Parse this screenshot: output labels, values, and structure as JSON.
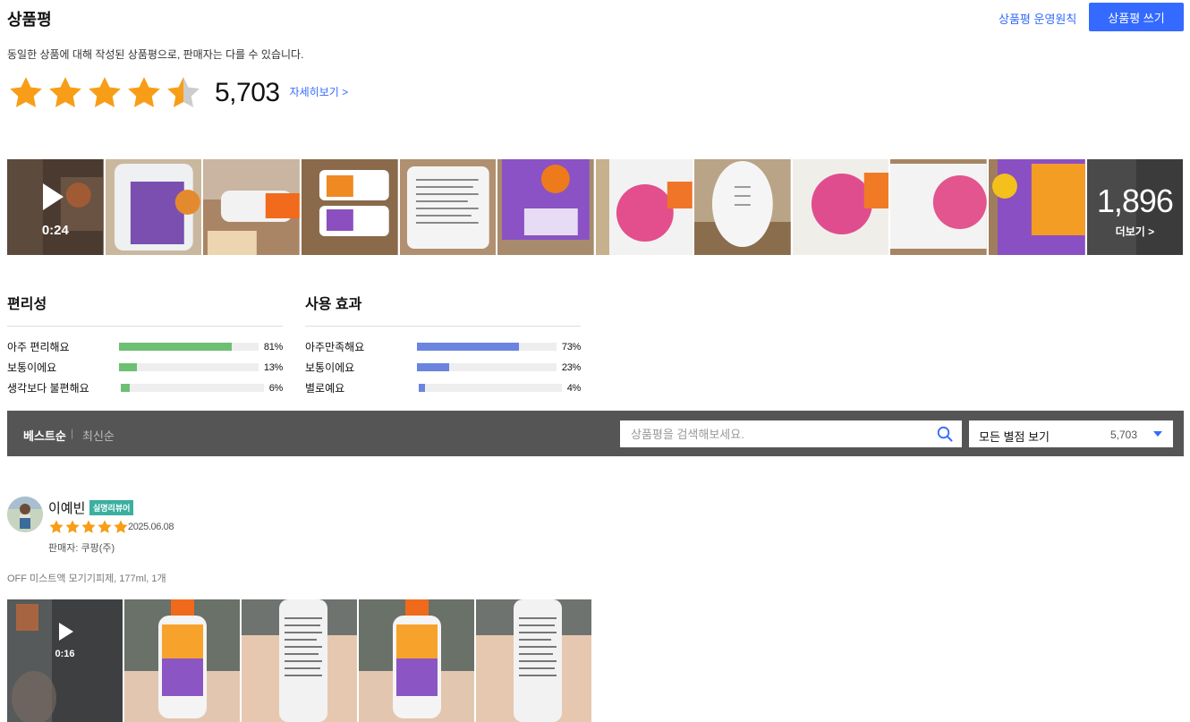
{
  "header": {
    "title": "상품평",
    "policy_link": "상품평 운영원칙",
    "write_button": "상품평 쓰기",
    "notice": "동일한 상품에 대해 작성된 상품평으로, 판매자는 다를 수 있습니다."
  },
  "summary": {
    "rating": 4.5,
    "max_rating": 5,
    "review_count": "5,703",
    "detail_link": "자세히보기 >"
  },
  "gallery": {
    "video_duration": "0:24",
    "more_count": "1,896",
    "more_label": "더보기 >"
  },
  "surveys": [
    {
      "title": "편리성",
      "color": "#6dbf73",
      "rows": [
        {
          "label": "아주 편리해요",
          "percent": 81,
          "percent_text": "81%"
        },
        {
          "label": "보통이에요",
          "percent": 13,
          "percent_text": "13%"
        },
        {
          "label": "생각보다 불편해요",
          "percent": 6,
          "percent_text": "6%"
        }
      ]
    },
    {
      "title": "사용 효과",
      "color": "#6b84e0",
      "rows": [
        {
          "label": "아주만족해요",
          "percent": 73,
          "percent_text": "73%"
        },
        {
          "label": "보통이에요",
          "percent": 23,
          "percent_text": "23%"
        },
        {
          "label": "별로예요",
          "percent": 4,
          "percent_text": "4%"
        }
      ]
    }
  ],
  "filter": {
    "sort_best": "베스트순",
    "sort_separator": "|",
    "sort_new": "최신순",
    "search_placeholder": "상품평을 검색해보세요.",
    "star_filter_label": "모든 별점 보기",
    "star_filter_count": "5,703"
  },
  "review": {
    "name": "이예빈",
    "badge": "실명리뷰어",
    "rating": 5,
    "date": "2025.06.08",
    "seller": "판매자: 쿠팡(주)",
    "product": "OFF 미스트액 모기기피제, 177ml, 1개",
    "video_duration": "0:16"
  },
  "colors": {
    "accent": "#346aff",
    "star": "#f89d17",
    "star_empty": "#cccccc",
    "filter_bar": "#555555",
    "badge": "#3bb0a0"
  }
}
